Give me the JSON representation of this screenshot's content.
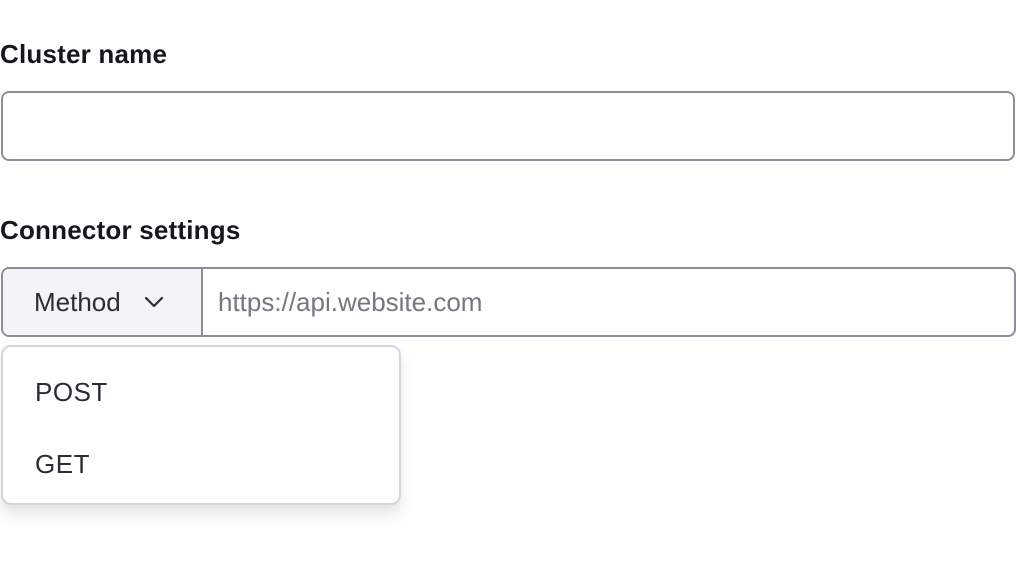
{
  "cluster": {
    "label": "Cluster name",
    "value": ""
  },
  "connector": {
    "label": "Connector settings",
    "method": {
      "label": "Method",
      "icon": "chevron-down-icon",
      "options": [
        "POST",
        "GET"
      ]
    },
    "url": {
      "placeholder": "https://api.website.com",
      "value": ""
    }
  },
  "colors": {
    "border": "#8e8c96",
    "select_bg": "#f4f4f6",
    "text": "#16161d",
    "placeholder": "#77767f"
  }
}
